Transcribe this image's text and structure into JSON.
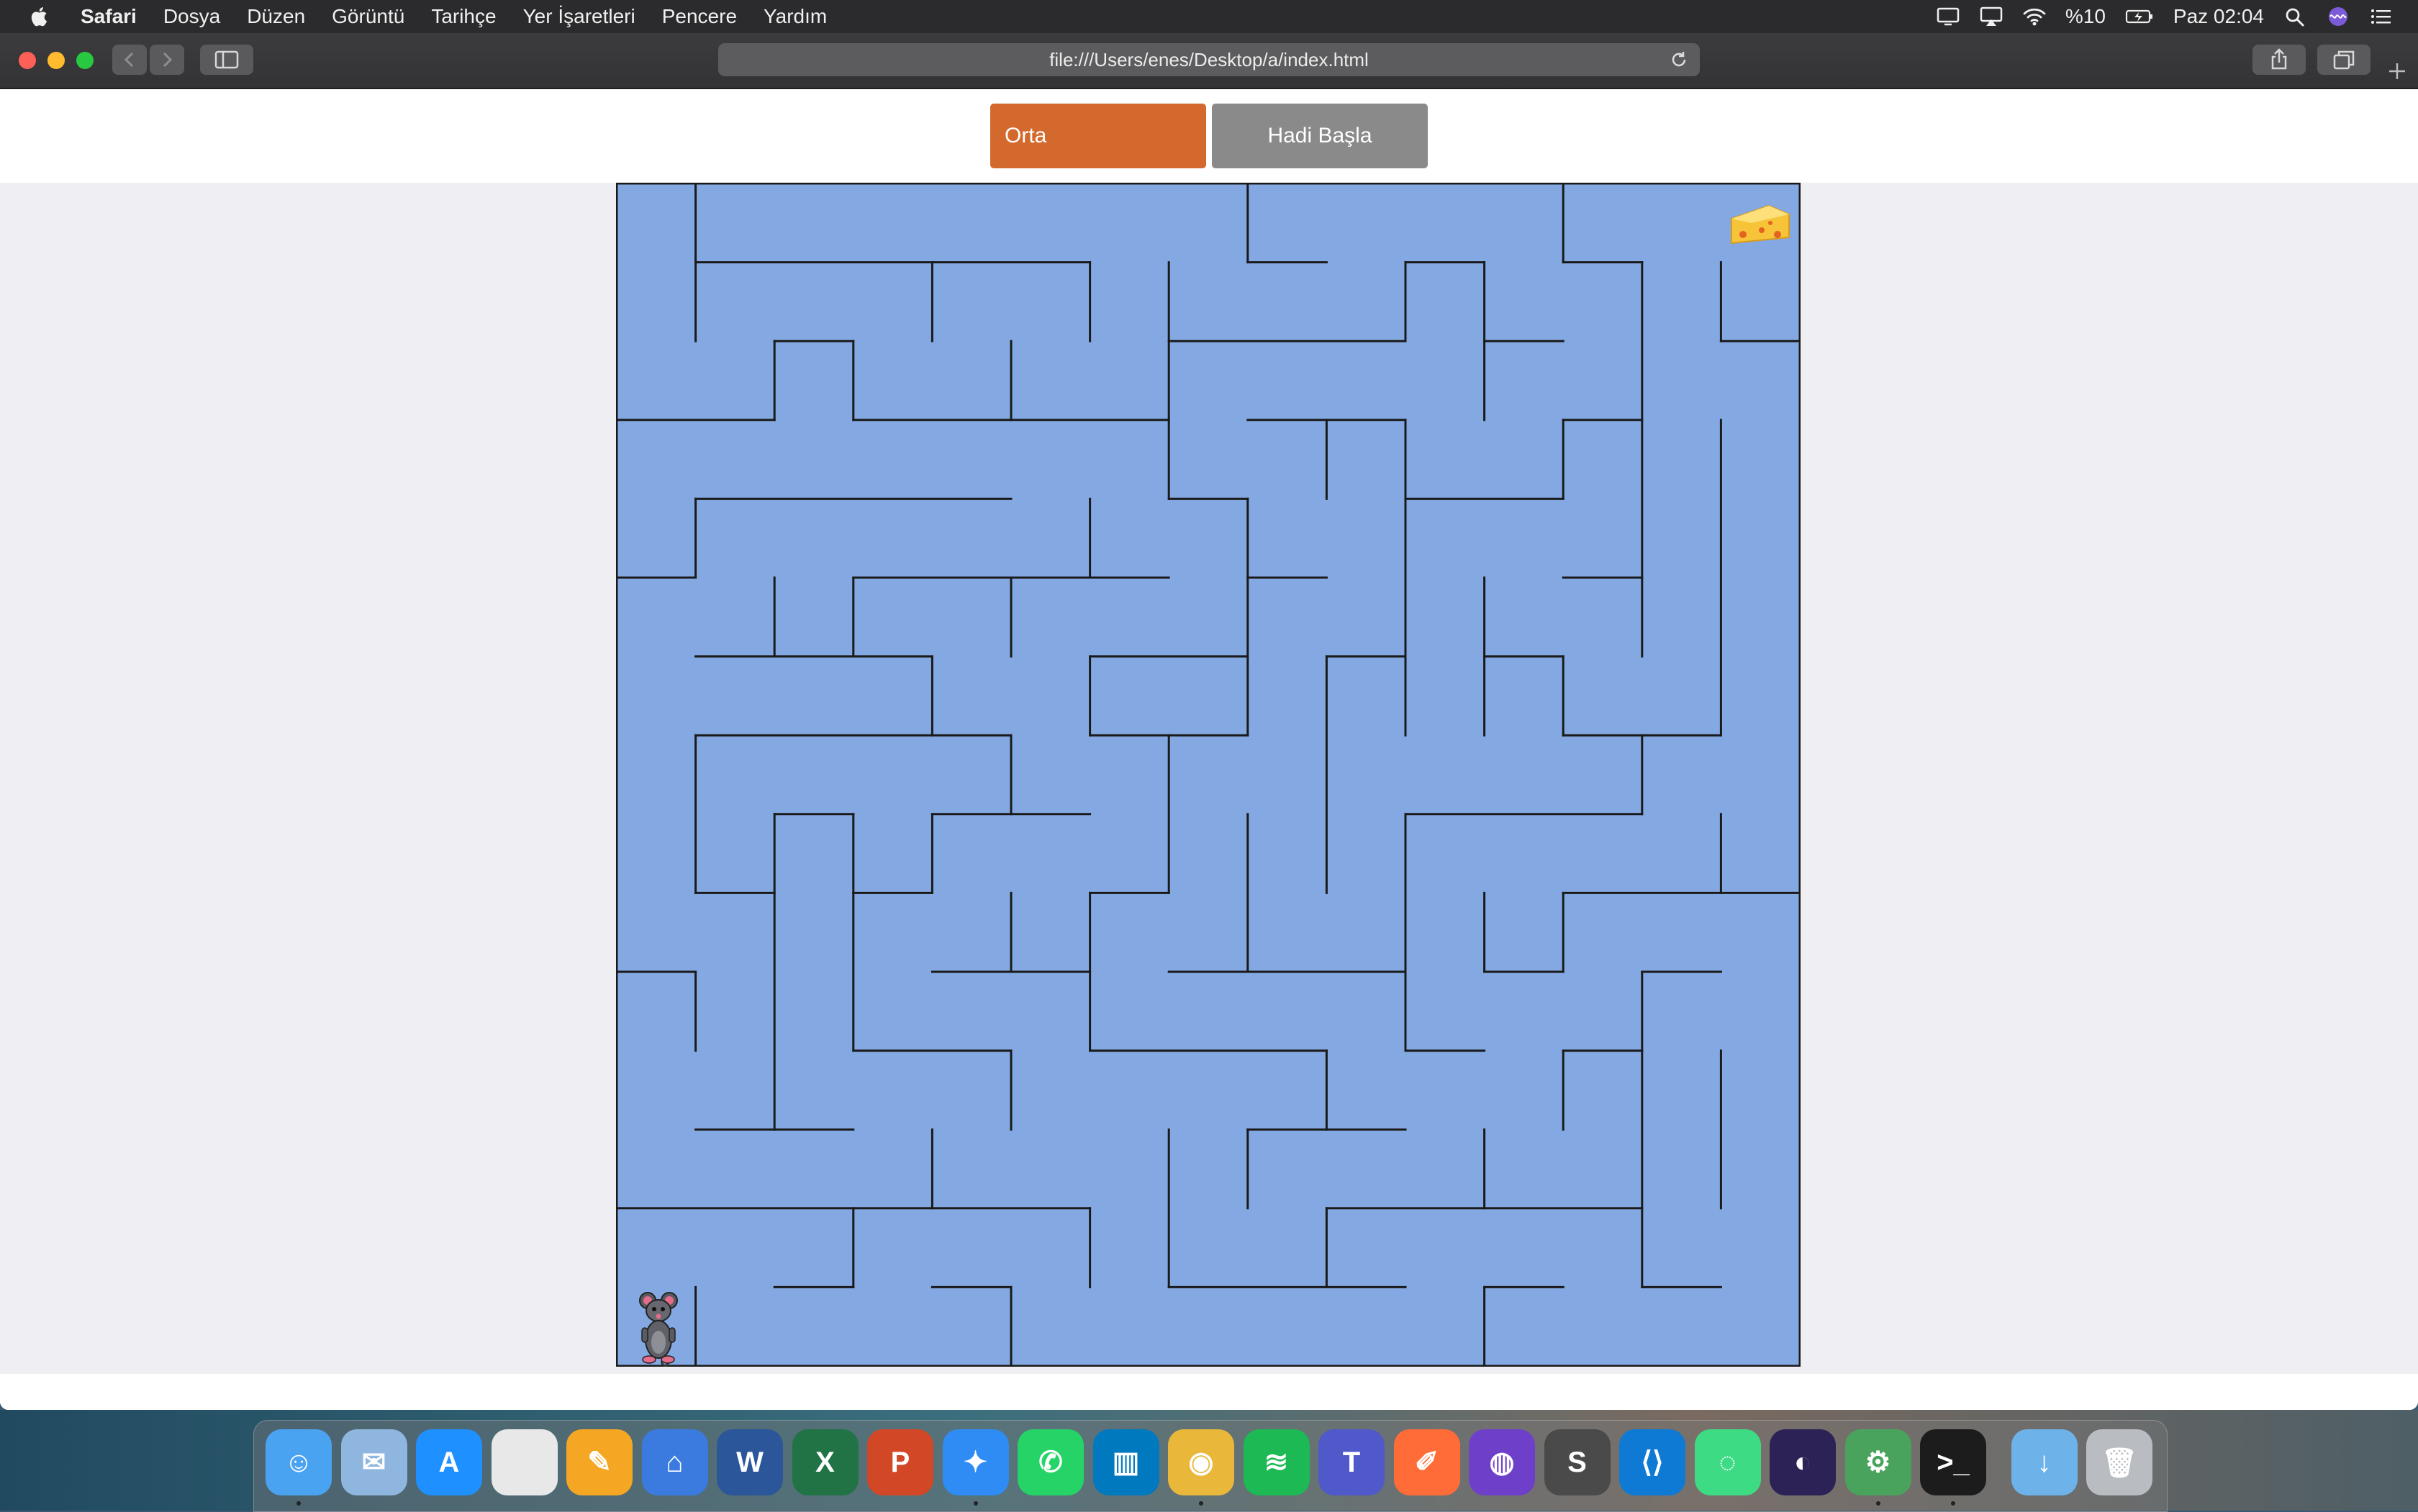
{
  "menubar": {
    "app_name": "Safari",
    "items": [
      "Dosya",
      "Düzen",
      "Görüntü",
      "Tarihçe",
      "Yer İşaretleri",
      "Pencere",
      "Yardım"
    ],
    "battery": "%10",
    "clock": "Paz 02:04"
  },
  "browser": {
    "url": "file:///Users/enes/Desktop/a/index.html"
  },
  "controls": {
    "level": "Orta",
    "start": "Hadi Başla"
  },
  "maze": {
    "cols": 15,
    "rows": 15,
    "wall_color": "#1a1a1a",
    "floor_color": "#84a9e2",
    "player": "mouse-icon",
    "goal": "cheese-icon"
  },
  "dock": {
    "apps": [
      "finder",
      "mail",
      "app-store",
      "numbers",
      "pages",
      "keynote",
      "word",
      "excel",
      "powerpoint",
      "safari",
      "whatsapp",
      "trello",
      "chrome",
      "spotify",
      "teams",
      "postman",
      "github",
      "sublime",
      "vscode",
      "android-studio-1",
      "eclipse",
      "android-studio-2",
      "terminal",
      "downloads",
      "trash"
    ]
  }
}
